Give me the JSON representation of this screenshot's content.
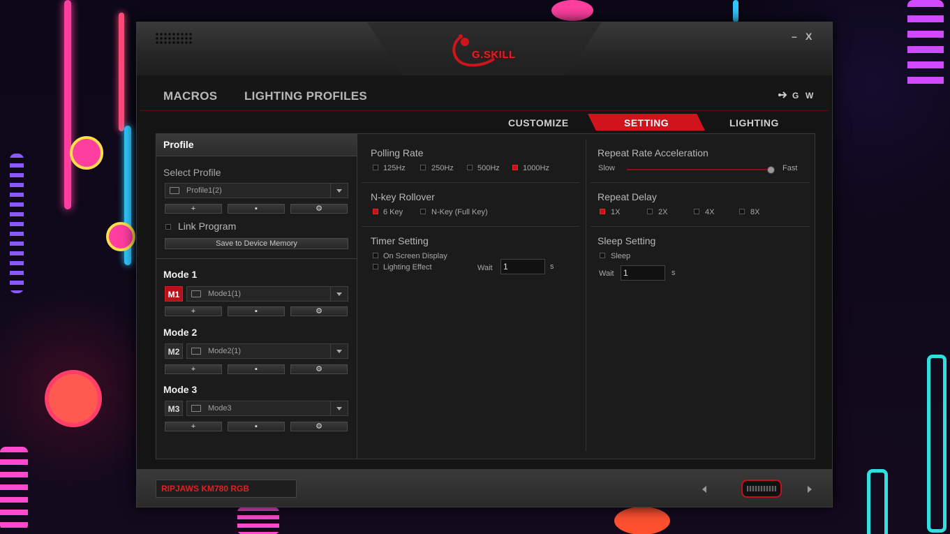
{
  "window": {
    "minimize": "–",
    "close": "X",
    "logo": "G.SKILL"
  },
  "nav": {
    "macros": "MACROS",
    "lighting_profiles": "LIGHTING PROFILES",
    "right_g": "G",
    "right_w": "W"
  },
  "subtabs": {
    "customize": "CUSTOMIZE",
    "setting": "SETTING",
    "lighting": "LIGHTING"
  },
  "left": {
    "header": "Profile",
    "select_profile_label": "Select Profile",
    "profile_value": "Profile1(2)",
    "link_program": "Link Program",
    "save_button": "Save to Device Memory",
    "modes": [
      {
        "label": "Mode 1",
        "badge": "M1",
        "value": "Mode1(1)"
      },
      {
        "label": "Mode 2",
        "badge": "M2",
        "value": "Mode2(1)"
      },
      {
        "label": "Mode 3",
        "badge": "M3",
        "value": "Mode3"
      }
    ],
    "btn_add": "+",
    "btn_delete": "▪",
    "btn_settings": "⚙"
  },
  "settings": {
    "polling_rate": {
      "title": "Polling Rate",
      "options": [
        "125Hz",
        "250Hz",
        "500Hz",
        "1000Hz"
      ],
      "selected": "1000Hz"
    },
    "nkey": {
      "title": "N-key Rollover",
      "options": [
        "6 Key",
        "N-Key (Full Key)"
      ],
      "selected": "6 Key"
    },
    "timer": {
      "title": "Timer Setting",
      "on_screen": "On Screen Display",
      "lighting_effect": "Lighting Effect",
      "wait_label": "Wait",
      "wait_value": "1",
      "unit": "s"
    },
    "repeat_accel": {
      "title": "Repeat Rate Acceleration",
      "slow": "Slow",
      "fast": "Fast",
      "level": 1.0
    },
    "repeat_delay": {
      "title": "Repeat Delay",
      "options": [
        "1X",
        "2X",
        "4X",
        "8X"
      ],
      "selected": "1X"
    },
    "sleep": {
      "title": "Sleep Setting",
      "sleep_label": "Sleep",
      "wait_label": "Wait",
      "wait_value": "1",
      "unit": "s"
    }
  },
  "footer": {
    "device": "RIPJAWS KM780 RGB"
  },
  "colors": {
    "accent": "#d0141c",
    "panel": "#1b1b1b"
  }
}
